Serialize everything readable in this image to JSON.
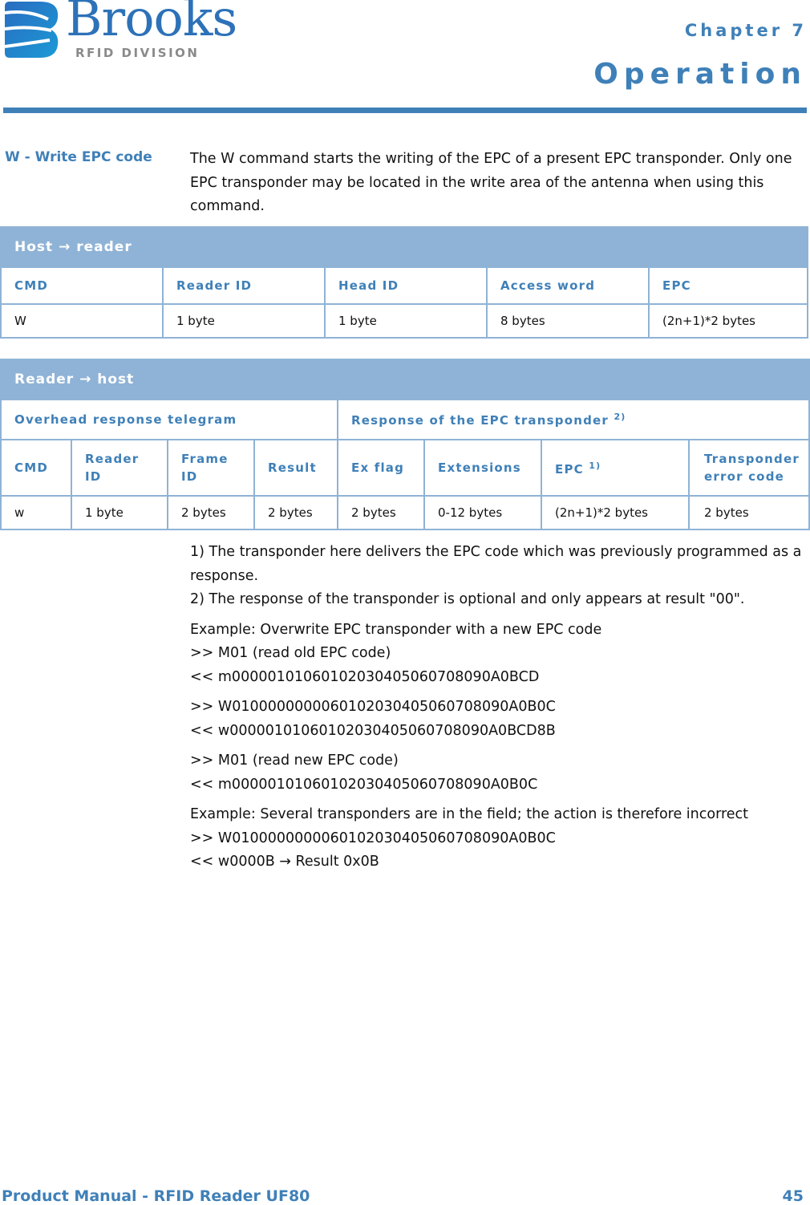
{
  "brand": {
    "name": "Brooks",
    "division": "RFID DIVISION",
    "logo_color": "#2d72b8",
    "sub_color": "#8a8a8a"
  },
  "header": {
    "chapter": "Chapter 7",
    "title": "Operation",
    "accent_color": "#3f80b8"
  },
  "section": {
    "label": "W - Write EPC code",
    "description": "The W command starts the writing of the EPC of a present EPC transponder. Only one EPC transponder may be located in the write area of the antenna when using this command."
  },
  "host_to_reader": {
    "title": "Host → reader",
    "columns": [
      "CMD",
      "Reader ID",
      "Head ID",
      "Access word",
      "EPC"
    ],
    "values": [
      "W",
      "1 byte",
      "1 byte",
      "8 bytes",
      "(2n+1)*2 bytes"
    ]
  },
  "reader_to_host": {
    "title": "Reader → host",
    "groups": [
      {
        "label": "Overhead response telegram",
        "note": ""
      },
      {
        "label": "Response of the EPC transponder",
        "note": "2)"
      }
    ],
    "columns": [
      {
        "label": "CMD",
        "note": ""
      },
      {
        "label": "Reader ID",
        "note": ""
      },
      {
        "label": "Frame ID",
        "note": ""
      },
      {
        "label": "Result",
        "note": ""
      },
      {
        "label": "Ex flag",
        "note": ""
      },
      {
        "label": "Extensions",
        "note": ""
      },
      {
        "label": "EPC",
        "note": "1)"
      },
      {
        "label": "Transponder error code",
        "note": ""
      }
    ],
    "values": [
      "w",
      "1 byte",
      "2 bytes",
      "2 bytes",
      "2 bytes",
      "0-12 bytes",
      "(2n+1)*2 bytes",
      "2 bytes"
    ]
  },
  "footnotes": [
    "1) The transponder here delivers the EPC code which was previously programmed as a response.",
    "2) The response of the transponder is optional and only appears at result \"00\"."
  ],
  "examples": [
    {
      "title": "Example: Overwrite EPC transponder with a new EPC code",
      "blocks": [
        [
          ">> M01 (read old EPC code)",
          "<< m00000101060102030405060708090A0BCD"
        ],
        [
          ">> W01000000000601020304050607080 90A0B0C",
          "<< w00000101060102030405060708090A0BCD8B"
        ],
        [
          ">> M01 (read new EPC code)",
          "<< m00000101060102030405060708090A0B0C"
        ]
      ]
    },
    {
      "title": "Example: Several transponders are in the field; the action is therefore incorrect",
      "blocks": [
        [
          ">> W010000000006010203040506070809 0A0B0C",
          "<< w0000B → Result 0x0B"
        ]
      ]
    }
  ],
  "footer": {
    "manual": "Product Manual - RFID Reader UF80",
    "page": "45"
  }
}
